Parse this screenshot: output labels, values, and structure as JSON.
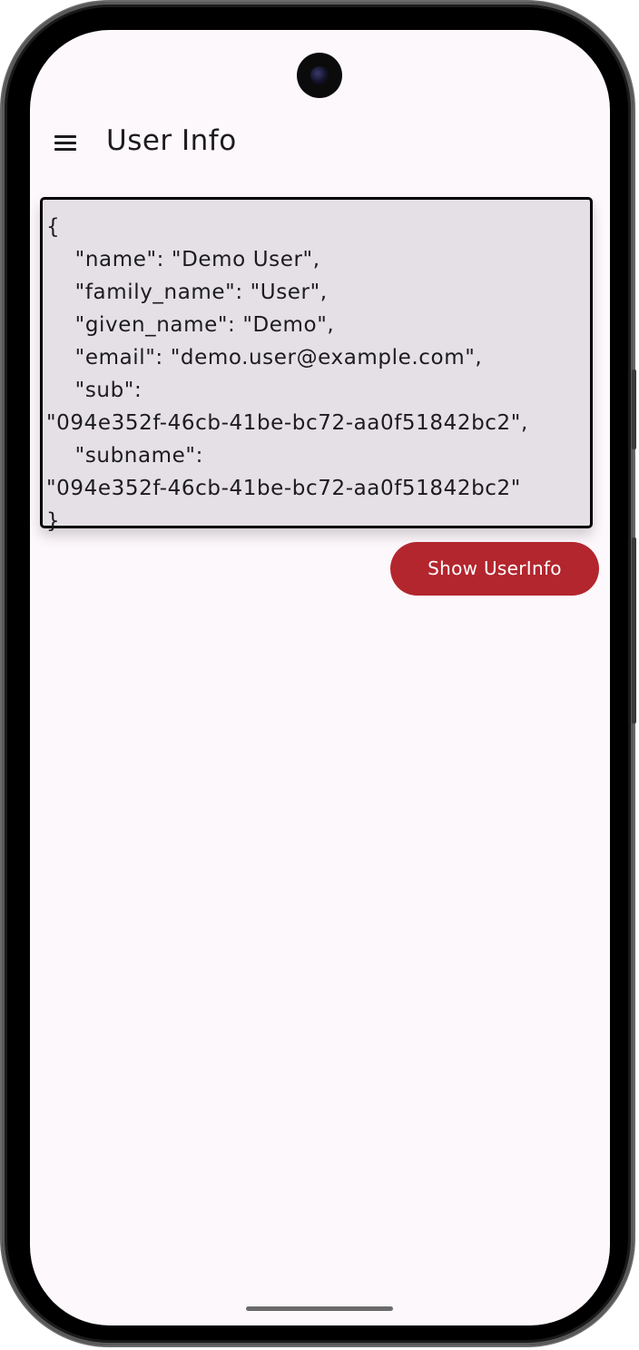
{
  "app_bar": {
    "title": "User Info",
    "menu_icon": "hamburger-menu-icon"
  },
  "userinfo_json": {
    "lines": [
      "{",
      "    \"name\": \"Demo User\",",
      "    \"family_name\": \"User\",",
      "    \"given_name\": \"Demo\",",
      "    \"email\": \"demo.user@example.com\",",
      "    \"sub\":",
      "\"094e352f-46cb-41be-bc72-aa0f51842bc2\",",
      "    \"subname\":",
      "\"094e352f-46cb-41be-bc72-aa0f51842bc2\"",
      "}"
    ]
  },
  "actions": {
    "show_userinfo_label": "Show UserInfo"
  },
  "colors": {
    "background": "#fdf8fc",
    "json_box_background": "#e4e0e5",
    "button_background": "#b3262e",
    "button_text": "#ffffff"
  }
}
